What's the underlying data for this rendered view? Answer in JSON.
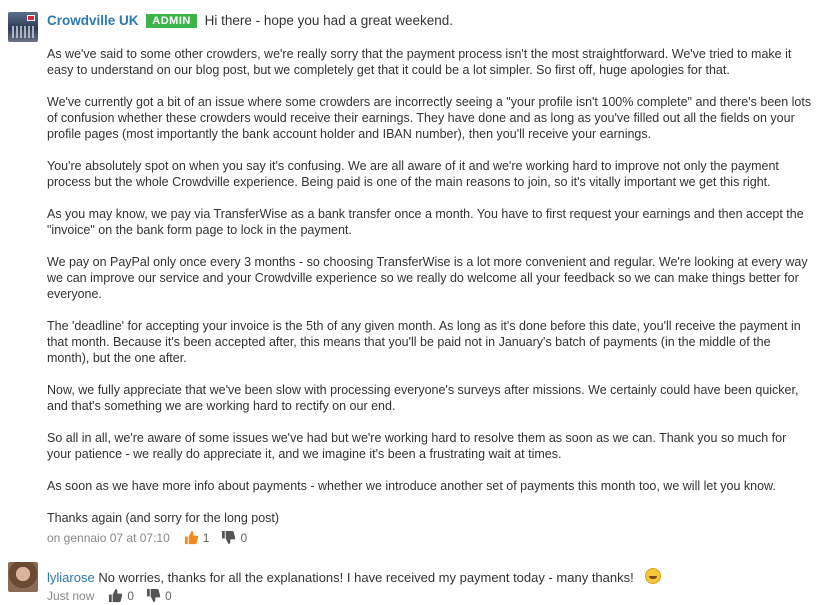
{
  "main_post": {
    "author": "Crowdville UK",
    "badge": "ADMIN",
    "greeting": "Hi there - hope you had a great weekend.",
    "paragraphs": [
      "As we've said to some other crowders, we're really sorry that the payment process isn't the most straightforward. We've tried to make it easy to understand on our blog post, but we completely get that it could be a lot simpler. So first off, huge apologies for that.",
      "We've currently got a bit of an issue where some crowders are incorrectly seeing a \"your profile isn't 100% complete\" and there's been lots of confusion whether these crowders would receive their earnings. They have done and as long as you've filled out all the fields on your profile pages (most importantly the bank account holder and IBAN number), then you'll receive your earnings.",
      "You're absolutely spot on when you say it's confusing. We are all aware of it and we're working hard to improve not only the payment process but the whole Crowdville experience. Being paid is one of the main reasons to join, so it's vitally important we get this right.",
      "As you may know, we pay via TransferWise as a bank transfer once a month. You have to first request your earnings and then accept the \"invoice\" on the bank form page to lock in the payment.",
      "We pay on PayPal only once every 3 months - so choosing TransferWise is a lot more convenient and regular. We're looking at every way we can improve our service and your Crowdville experience so we really do welcome all your feedback so we can make things better for everyone.",
      "The 'deadline' for accepting your invoice is the 5th of any given month. As long as it's done before this date, you'll receive the payment in that month. Because it's been accepted after, this means that you'll be paid not in January's batch of payments (in the middle of the month), but the one after.",
      "Now, we fully appreciate that we've been slow with processing everyone's surveys after missions. We certainly could have been quicker, and that's something we are working hard to rectify on our end.",
      "So all in all, we're aware of some issues we've had but we're working hard to resolve them as soon as we can. Thank you so much for your patience - we really do appreciate it, and we imagine it's been a frustrating wait at times.",
      "As soon as we have more info about payments - whether we introduce another set of payments this month too, we will let you know.",
      "Thanks again (and sorry for the long post)"
    ],
    "timestamp": "on gennaio 07 at 07:10",
    "likes": "1",
    "dislikes": "0"
  },
  "reply": {
    "author": "lyliarose",
    "text": "No worries, thanks for all the explanations! I have received my payment today - many thanks!",
    "emoji": "grinning-face-emoji",
    "timestamp": "Just now",
    "likes": "0",
    "dislikes": "0"
  },
  "icons": {
    "like": "thumbs-up-icon",
    "dislike": "thumbs-down-icon"
  },
  "colors": {
    "author_link": "#2a7ab0",
    "admin_badge": "#3bb54a",
    "like_active": "#f08a24",
    "icon_gray": "#555555"
  }
}
